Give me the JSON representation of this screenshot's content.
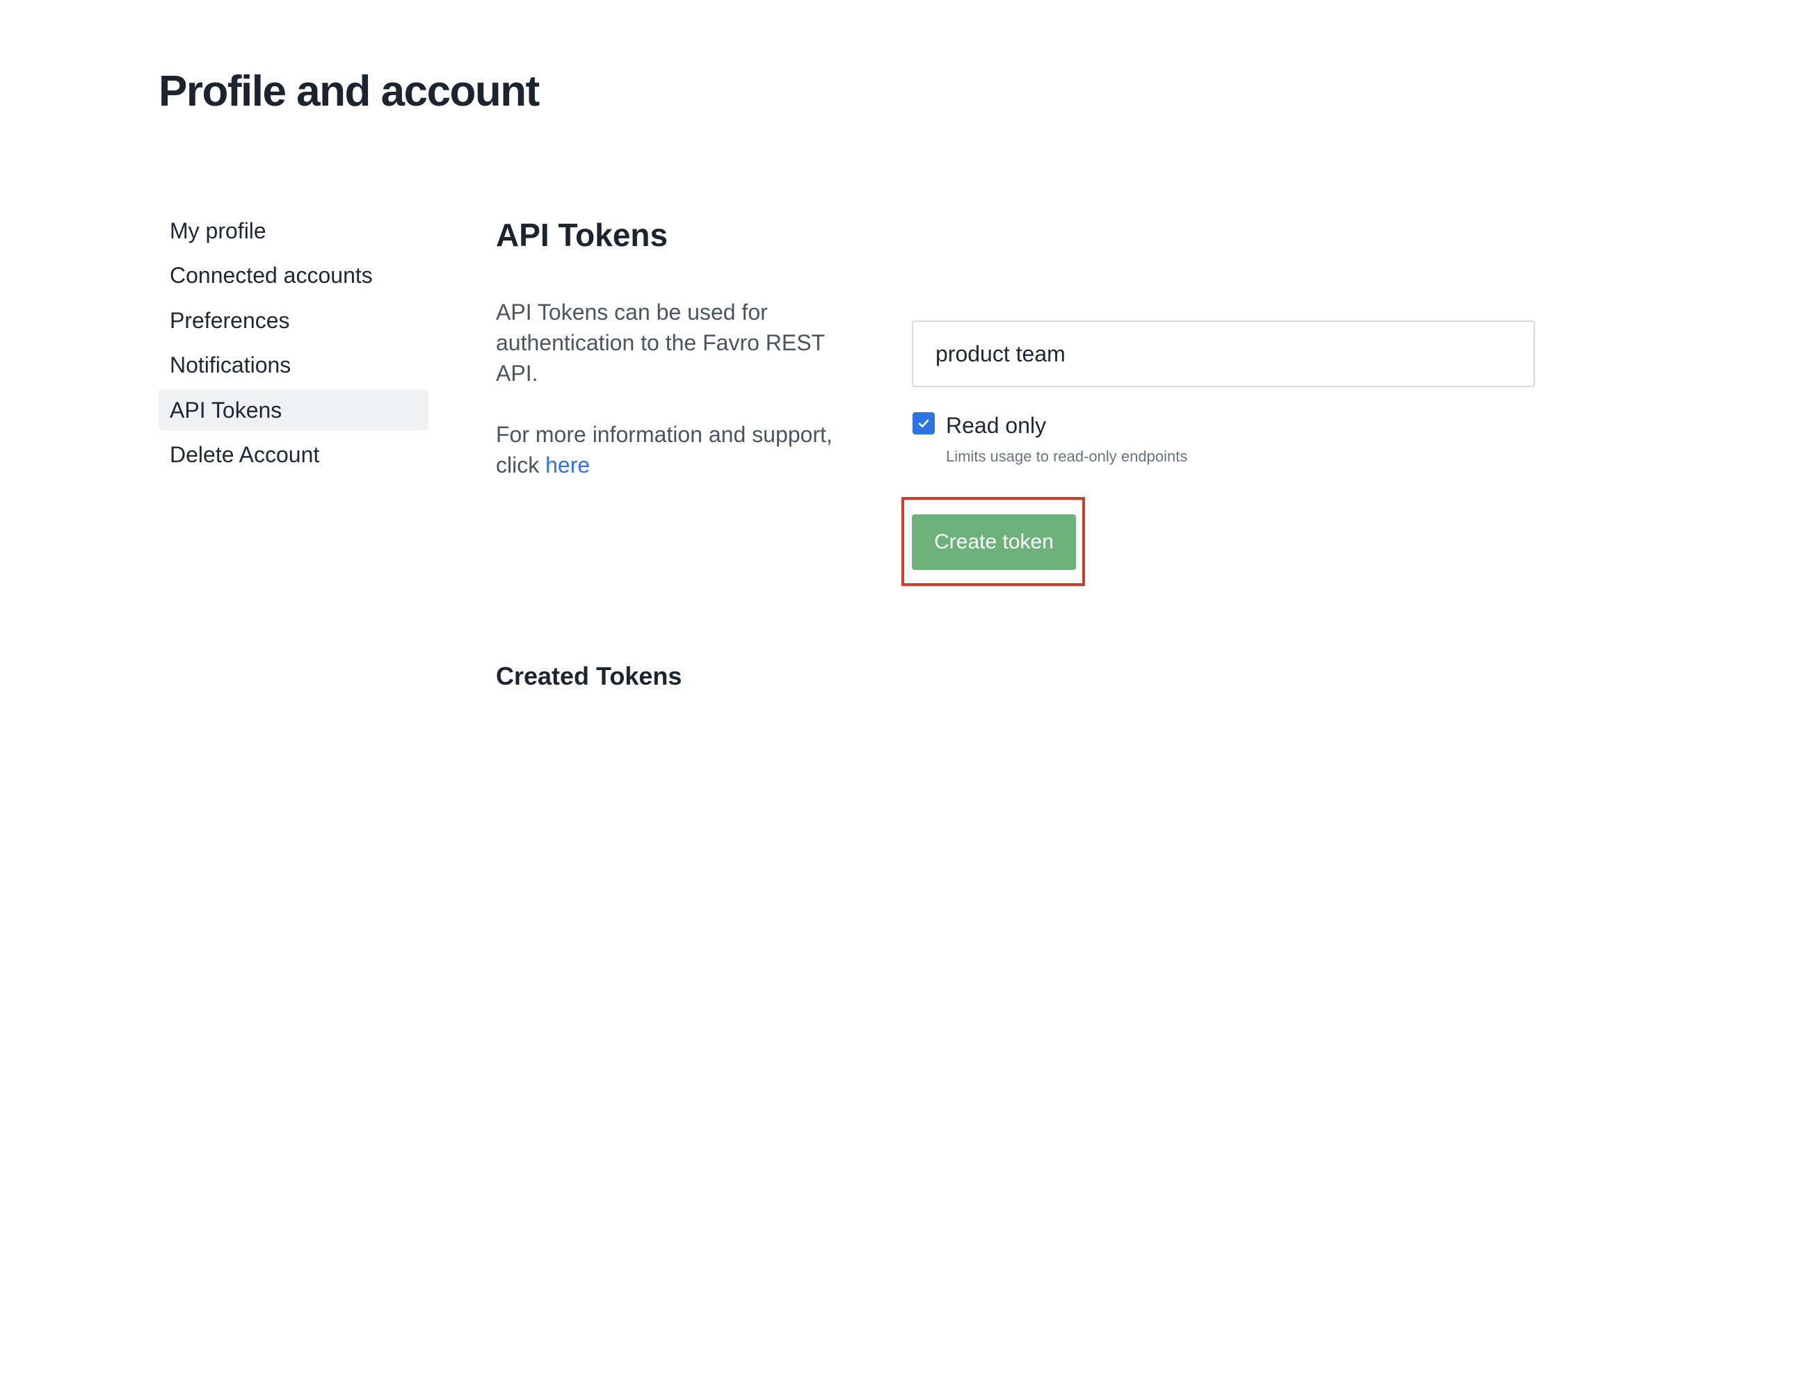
{
  "page": {
    "title": "Profile and account"
  },
  "sidebar": {
    "items": [
      {
        "label": "My profile",
        "active": false
      },
      {
        "label": "Connected accounts",
        "active": false
      },
      {
        "label": "Preferences",
        "active": false
      },
      {
        "label": "Notifications",
        "active": false
      },
      {
        "label": "API Tokens",
        "active": true
      },
      {
        "label": "Delete Account",
        "active": false
      }
    ]
  },
  "main": {
    "section_title": "API Tokens",
    "description_line": "API Tokens can be used for authentication to the Favro REST API.",
    "support_text": "For more information and support, click",
    "support_link": "here",
    "token_name_value": "product team",
    "read_only": {
      "label": "Read only",
      "checked": true,
      "hint": "Limits usage to read-only endpoints"
    },
    "create_button_label": "Create token",
    "created_tokens_title": "Created Tokens"
  },
  "colors": {
    "accent": "#2f74e6",
    "button_green": "#6db17b",
    "highlight_red": "#d43c2a",
    "active_item_bg": "#f0f1f3"
  }
}
